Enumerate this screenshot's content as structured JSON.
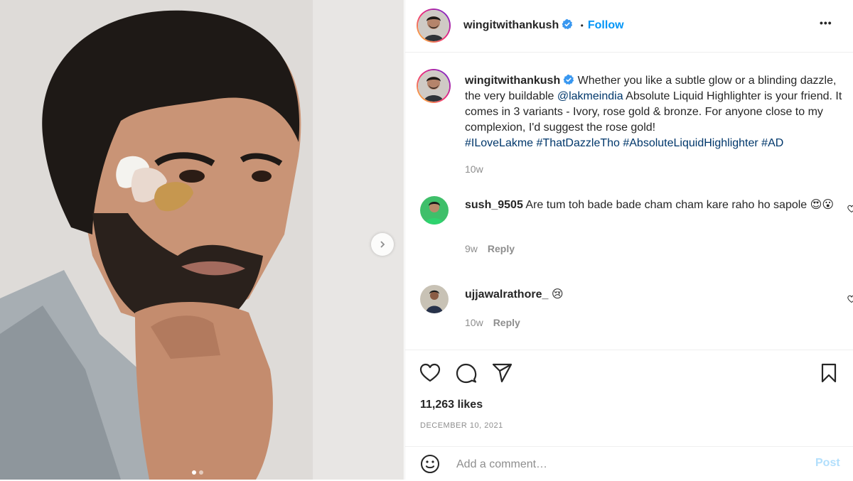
{
  "post": {
    "username": "wingitwithankush",
    "follow_label": "Follow",
    "separator": "•",
    "more_label": "•••",
    "caption_text_1": " Whether you like a subtle glow or a blinding dazzle, the very buildable ",
    "caption_mention": "@lakmeindia",
    "caption_text_2": " Absolute Liquid Highlighter is your friend. It comes in 3 variants - Ivory, rose gold & bronze. For anyone close to my complexion, I'd suggest the rose gold!",
    "hashtags": [
      "#ILoveLakme",
      "#ThatDazzleTho",
      "#AbsoluteLiquidHighlighter",
      "#AD"
    ],
    "caption_age": "10w",
    "likes": "11,263 likes",
    "date": "December 10, 2021"
  },
  "comments": [
    {
      "username": "sush_9505",
      "text": "Are tum toh bade bade cham cham kare raho ho sapole 😍😮",
      "age": "9w",
      "reply_label": "Reply"
    },
    {
      "username": "ujjawalrathore_",
      "text": "😢",
      "age": "10w",
      "reply_label": "Reply"
    }
  ],
  "add_comment": {
    "placeholder": "Add a comment…",
    "post_label": "Post"
  },
  "carousel": {
    "total": 2,
    "current": 1
  },
  "colors": {
    "accent": "#0095f6",
    "link": "#00376b",
    "muted": "#8e8e8e",
    "verified": "#3897f0"
  },
  "icons": [
    "chevron-right-icon",
    "verified-icon",
    "more-icon",
    "heart-icon",
    "comment-icon",
    "share-icon",
    "bookmark-icon",
    "emoji-icon"
  ]
}
